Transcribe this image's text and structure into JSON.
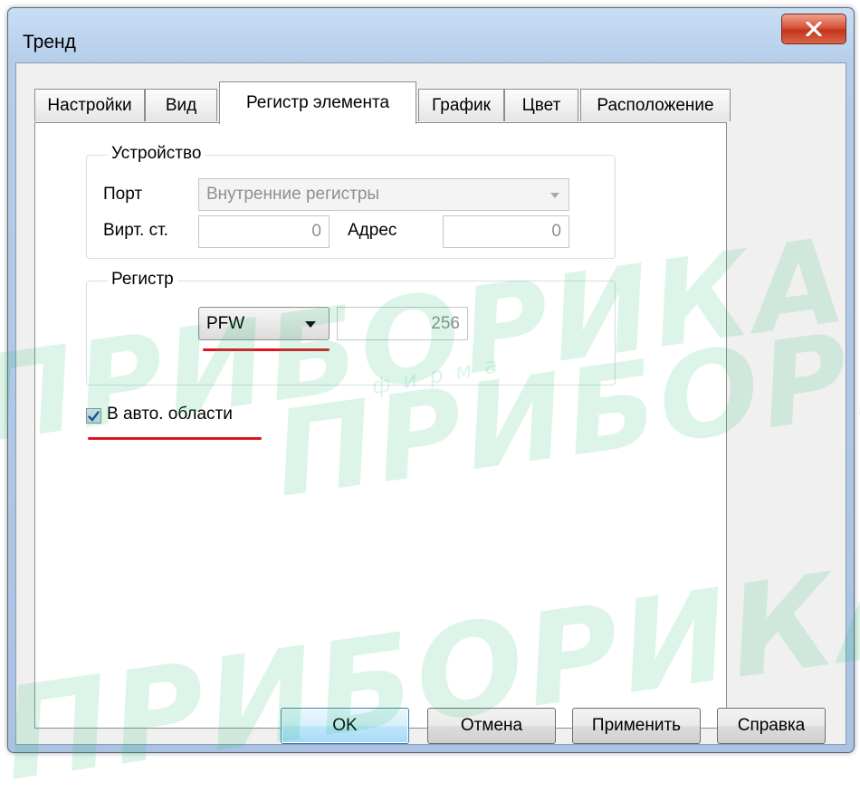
{
  "window": {
    "title": "Тренд"
  },
  "tabs": [
    {
      "label": "Настройки"
    },
    {
      "label": "Вид"
    },
    {
      "label": "Регистр элемента"
    },
    {
      "label": "График"
    },
    {
      "label": "Цвет"
    },
    {
      "label": "Расположение"
    }
  ],
  "active_tab": "Регистр элемента",
  "device_group": {
    "legend": "Устройство",
    "port_label": "Порт",
    "port_value": "Внутренние регистры",
    "virt_label": "Вирт. ст.",
    "virt_value": "0",
    "address_label": "Адрес",
    "address_value": "0"
  },
  "register_group": {
    "legend": "Регистр",
    "register_type": "PFW",
    "register_value": "256"
  },
  "auto_area": {
    "label": "В авто. области",
    "checked": true
  },
  "buttons": {
    "ok": "OK",
    "cancel": "Отмена",
    "apply": "Применить",
    "help": "Справка"
  },
  "watermark": {
    "brand": "ПРИБОРИКА",
    "sub": "фирма"
  },
  "colors": {
    "highlight_underline": "#e0141e",
    "close_button": "#c3341c",
    "watermark": "#28be6e"
  }
}
